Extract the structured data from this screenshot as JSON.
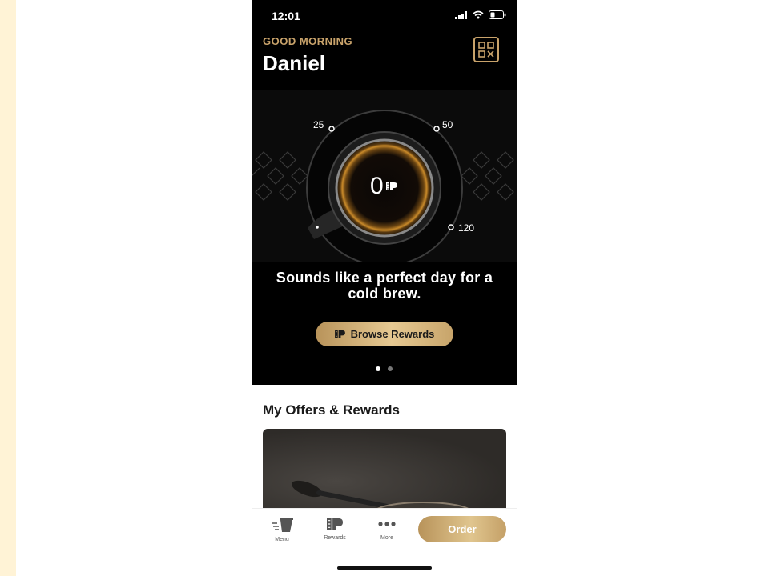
{
  "status_bar": {
    "time": "12:01"
  },
  "header": {
    "greeting": "GOOD MORNING",
    "user_name": "Daniel"
  },
  "icons": {
    "qr": "qr-code-icon",
    "rewards": "rewards-p-icon",
    "menu": "coffee-cup-icon",
    "more": "more-dots-icon"
  },
  "points": {
    "value": "0",
    "progress_fraction": 0,
    "milestones": [
      {
        "label": "25"
      },
      {
        "label": "50"
      },
      {
        "label": "120"
      }
    ]
  },
  "tagline": "Sounds like a perfect day for a cold brew.",
  "browse_button": {
    "label": "Browse Rewards"
  },
  "carousel": {
    "pages": 2,
    "active": 1
  },
  "offers": {
    "title": "My Offers & Rewards"
  },
  "tab_bar": {
    "items": [
      {
        "label": "Menu"
      },
      {
        "label": "Rewards"
      },
      {
        "label": "More"
      }
    ],
    "order_label": "Order"
  },
  "colors": {
    "accent_gold": "#c9a36b",
    "background": "#000000",
    "left_strip": "#fff3d6"
  }
}
